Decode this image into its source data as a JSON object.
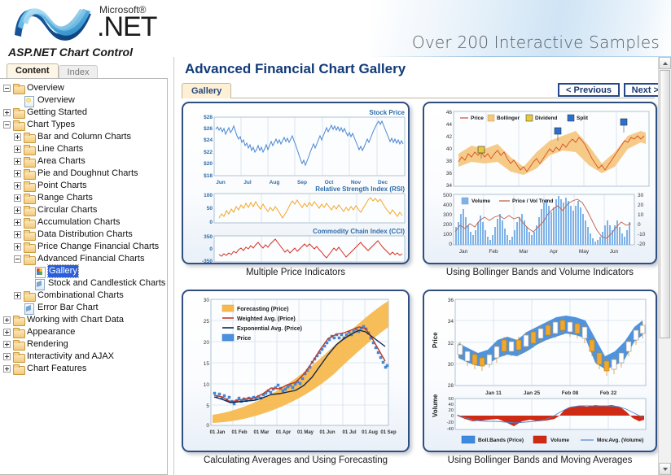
{
  "banner": {
    "brand_microsoft": "Microsoft®",
    "brand_net": ".NET",
    "tagline": "Over 200 Interactive Samples",
    "product_title": "ASP.NET Chart Control"
  },
  "sidebar": {
    "tabs": [
      {
        "label": "Content",
        "active": true
      },
      {
        "label": "Index",
        "active": false
      }
    ],
    "tree": [
      {
        "label": "Overview",
        "indent": 0,
        "expander": "minus",
        "icon": "folder-icon",
        "selected": false
      },
      {
        "label": "Overview",
        "indent": 1,
        "expander": "none",
        "icon": "bulb-icon",
        "selected": false
      },
      {
        "label": "Getting Started",
        "indent": 0,
        "expander": "plus",
        "icon": "folder-icon",
        "selected": false
      },
      {
        "label": "Chart Types",
        "indent": 0,
        "expander": "minus",
        "icon": "folder-icon",
        "selected": false
      },
      {
        "label": "Bar and Column Charts",
        "indent": 1,
        "expander": "plus",
        "icon": "folder-icon",
        "selected": false
      },
      {
        "label": "Line Charts",
        "indent": 1,
        "expander": "plus",
        "icon": "folder-icon",
        "selected": false
      },
      {
        "label": "Area Charts",
        "indent": 1,
        "expander": "plus",
        "icon": "folder-icon",
        "selected": false
      },
      {
        "label": "Pie and Doughnut Charts",
        "indent": 1,
        "expander": "plus",
        "icon": "folder-icon",
        "selected": false
      },
      {
        "label": "Point Charts",
        "indent": 1,
        "expander": "plus",
        "icon": "folder-icon",
        "selected": false
      },
      {
        "label": "Range Charts",
        "indent": 1,
        "expander": "plus",
        "icon": "folder-icon",
        "selected": false
      },
      {
        "label": "Circular Charts",
        "indent": 1,
        "expander": "plus",
        "icon": "folder-icon",
        "selected": false
      },
      {
        "label": "Accumulation Charts",
        "indent": 1,
        "expander": "plus",
        "icon": "folder-icon",
        "selected": false
      },
      {
        "label": "Data Distribution Charts",
        "indent": 1,
        "expander": "plus",
        "icon": "folder-icon",
        "selected": false
      },
      {
        "label": "Price Change Financial Charts",
        "indent": 1,
        "expander": "plus",
        "icon": "folder-icon",
        "selected": false
      },
      {
        "label": "Advanced Financial Charts",
        "indent": 1,
        "expander": "minus",
        "icon": "folder-icon",
        "selected": false
      },
      {
        "label": "Gallery",
        "indent": 2,
        "expander": "none",
        "icon": "gallery-icon",
        "selected": true
      },
      {
        "label": "Stock and Candlestick Charts",
        "indent": 2,
        "expander": "none",
        "icon": "page-icon",
        "selected": false
      },
      {
        "label": "Combinational Charts",
        "indent": 1,
        "expander": "plus",
        "icon": "folder-icon",
        "selected": false
      },
      {
        "label": "Error Bar Chart",
        "indent": 1,
        "expander": "none",
        "icon": "page-icon",
        "selected": false
      },
      {
        "label": "Working with Chart Data",
        "indent": 0,
        "expander": "plus",
        "icon": "folder-icon",
        "selected": false
      },
      {
        "label": "Appearance",
        "indent": 0,
        "expander": "plus",
        "icon": "folder-icon",
        "selected": false
      },
      {
        "label": "Rendering",
        "indent": 0,
        "expander": "plus",
        "icon": "folder-icon",
        "selected": false
      },
      {
        "label": "Interactivity and AJAX",
        "indent": 0,
        "expander": "plus",
        "icon": "folder-icon",
        "selected": false
      },
      {
        "label": "Chart Features",
        "indent": 0,
        "expander": "plus",
        "icon": "folder-icon",
        "selected": false
      }
    ]
  },
  "main": {
    "page_title": "Advanced Financial Chart Gallery",
    "tab_label": "Gallery",
    "prev_label": "< Previous",
    "next_label": "Next >"
  },
  "colors": {
    "title_blue": "#123b78",
    "tab_cream": "#fdf0d5",
    "thumb_border": "#2f4f82",
    "price_blue": "#4a86d0",
    "rsi_orange": "#f5a623",
    "cci_red": "#d62d20",
    "bollinger_band": "#f5c77e",
    "forecast_band": "#f7b94f",
    "weighted_red": "#c0392b",
    "exp_navy": "#11264f",
    "volume_blue": "#7fb3e8",
    "bb_blue": "#3d8ae0",
    "volume_red": "#cf2a13"
  },
  "chart_data": [
    {
      "type": "line",
      "id": "multiple-price-indicators",
      "caption": "Multiple Price Indicators",
      "panels": [
        {
          "title": "Stock Price",
          "ylabel": "",
          "yticks": [
            "$18",
            "$20",
            "$22",
            "$24",
            "$26",
            "$28"
          ],
          "ylim": [
            18,
            28
          ],
          "xticks": [
            "Jun",
            "Jul",
            "Aug",
            "Sep",
            "Oct",
            "Nov",
            "Dec"
          ],
          "series": [
            {
              "name": "Stock Price",
              "color": "#4a86d0"
            }
          ],
          "grid": true
        },
        {
          "title": "Relative Strength Index (RSI)",
          "yticks": [
            "0",
            "50",
            "100"
          ],
          "ylim": [
            0,
            100
          ],
          "xticks": [],
          "series": [
            {
              "name": "RSI",
              "color": "#f5a623"
            }
          ],
          "grid": true
        },
        {
          "title": "Commodity Chain Index (CCI)",
          "yticks": [
            "-350",
            "0",
            "350"
          ],
          "ylim": [
            -350,
            350
          ],
          "xticks": [],
          "series": [
            {
              "name": "CCI",
              "color": "#d62d20"
            }
          ],
          "grid": true
        }
      ]
    },
    {
      "type": "line",
      "id": "bollinger-volume",
      "caption": "Using Bollinger Bands and Volume Indicators",
      "panels": [
        {
          "title": "",
          "yticks": [
            "34",
            "36",
            "38",
            "40",
            "42",
            "44",
            "46"
          ],
          "ylim": [
            34,
            46
          ],
          "xticks": [],
          "legend": [
            {
              "label": "Price",
              "marker": "line",
              "color": "#d9502b"
            },
            {
              "label": "Bollinger",
              "marker": "square",
              "color": "#f5c77e"
            },
            {
              "label": "Dividend",
              "marker": "badge",
              "color": "#e8c93a"
            },
            {
              "label": "Split",
              "marker": "badge",
              "color": "#2b6fd1"
            }
          ],
          "grid": true
        },
        {
          "title": "",
          "yticks": [
            "0",
            "100",
            "200",
            "300",
            "400",
            "500"
          ],
          "ylim": [
            0,
            500
          ],
          "y2ticks": [
            "-20",
            "-10",
            "0",
            "10",
            "20",
            "30"
          ],
          "y2lim": [
            -20,
            30
          ],
          "xticks": [
            "Jan",
            "Feb",
            "Mar",
            "Apr",
            "May",
            "Jun"
          ],
          "legend": [
            {
              "label": "Volume",
              "marker": "square",
              "color": "#7fb3e8"
            },
            {
              "label": "Price / Vol Trend",
              "marker": "line",
              "color": "#c0604a"
            }
          ],
          "grid": true
        }
      ]
    },
    {
      "type": "scatter",
      "id": "averages-forecasting",
      "caption": "Calculating Averages and Using Forecasting",
      "panels": [
        {
          "title": "",
          "yticks": [
            "0",
            "5",
            "10",
            "15",
            "20",
            "25",
            "30"
          ],
          "ylim": [
            0,
            30
          ],
          "xticks": [
            "01 Jan",
            "01 Feb",
            "01 Mar",
            "01 Apr",
            "01 May",
            "01 Jun",
            "01 Jul",
            "01 Aug",
            "01 Sep"
          ],
          "legend": [
            {
              "label": "Forecasting (Price)",
              "marker": "square",
              "color": "#f7b94f"
            },
            {
              "label": "Weighted Avg. (Price)",
              "marker": "line",
              "color": "#c0392b"
            },
            {
              "label": "Exponential Avg. (Price)",
              "marker": "line",
              "color": "#11264f"
            },
            {
              "label": "Price",
              "marker": "square",
              "color": "#4a90e2"
            }
          ],
          "grid": true
        }
      ]
    },
    {
      "type": "candlestick",
      "id": "bollinger-moving-averages",
      "caption": "Using Bollinger Bands and Moving Averages",
      "panels": [
        {
          "title": "",
          "ylabel": "Price",
          "yticks": [
            "28",
            "30",
            "32",
            "34",
            "36"
          ],
          "ylim": [
            28,
            36
          ],
          "xticks": [
            "Jan 11",
            "Jan 25",
            "Feb 08",
            "Feb 22"
          ],
          "grid": true
        },
        {
          "title": "",
          "ylabel": "Volume",
          "yticks": [
            "-40",
            "-20",
            "0",
            "20",
            "40",
            "60"
          ],
          "ylim": [
            -40,
            60
          ],
          "xticks": [],
          "legend": [
            {
              "label": "Boll.Bands (Price)",
              "marker": "square",
              "color": "#3d8ae0"
            },
            {
              "label": "Volume",
              "marker": "square",
              "color": "#cf2a13"
            },
            {
              "label": "Mov.Avg. (Volume)",
              "marker": "line",
              "color": "#4a86d0"
            }
          ],
          "grid": true
        }
      ]
    }
  ]
}
